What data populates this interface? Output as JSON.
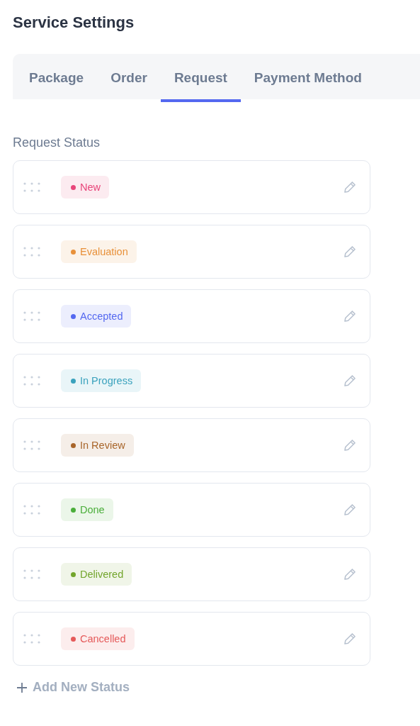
{
  "title": "Service Settings",
  "tabs": [
    {
      "label": "Package",
      "selected": false
    },
    {
      "label": "Order",
      "selected": false
    },
    {
      "label": "Request",
      "selected": true
    },
    {
      "label": "Payment Method",
      "selected": false
    }
  ],
  "section_title": "Request Status",
  "statuses": [
    {
      "label": "New",
      "color": "#e8457a"
    },
    {
      "label": "Evaluation",
      "color": "#e8913a"
    },
    {
      "label": "Accepted",
      "color": "#5468f0"
    },
    {
      "label": "In Progress",
      "color": "#3aa2bd"
    },
    {
      "label": "In Review",
      "color": "#a8652a"
    },
    {
      "label": "Done",
      "color": "#4aae3a"
    },
    {
      "label": "Delivered",
      "color": "#72a52c"
    },
    {
      "label": "Cancelled",
      "color": "#e55a5a"
    }
  ],
  "add_button": {
    "label": "Add New Status"
  }
}
